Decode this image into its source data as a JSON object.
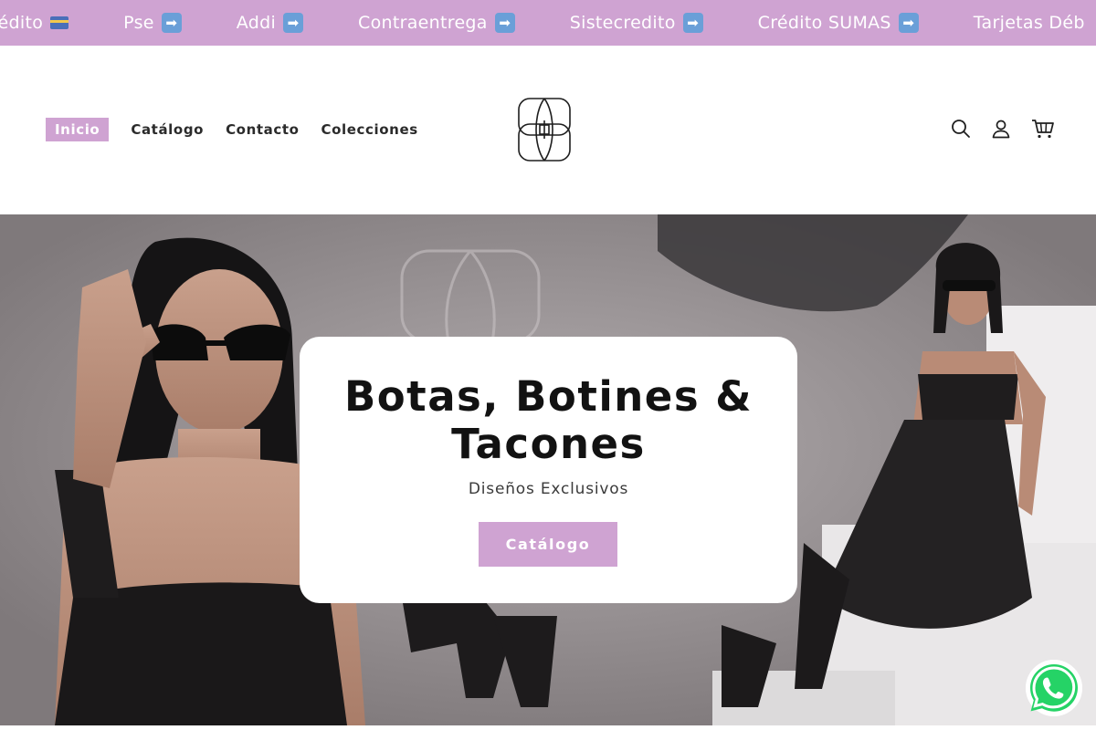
{
  "announcement": {
    "items": [
      {
        "text": "o Crédito",
        "icon": "credit-card-icon"
      },
      {
        "text": "Pse",
        "icon": "right-arrow-icon"
      },
      {
        "text": "Addi",
        "icon": "right-arrow-icon"
      },
      {
        "text": "Contraentrega",
        "icon": "right-arrow-icon"
      },
      {
        "text": "Sistecredito",
        "icon": "right-arrow-icon"
      },
      {
        "text": "Crédito SUMAS",
        "icon": "right-arrow-icon"
      },
      {
        "text": "Tarjetas Déb",
        "icon": ""
      }
    ],
    "arrow_glyph": "➡",
    "background": "#cfa3d2"
  },
  "nav": {
    "items": [
      "Inicio",
      "Catálogo",
      "Contacto",
      "Colecciones"
    ],
    "active": "Inicio"
  },
  "header_icons": [
    "search-icon",
    "account-icon",
    "cart-icon"
  ],
  "hero": {
    "title": "Botas, Botines & Tacones",
    "subtitle": "Diseños Exclusivos",
    "button": "Catálogo"
  },
  "colors": {
    "accent": "#cfa3d2",
    "text": "#121212",
    "whatsapp": "#25d366"
  },
  "whatsapp": {
    "icon": "whatsapp-icon"
  }
}
